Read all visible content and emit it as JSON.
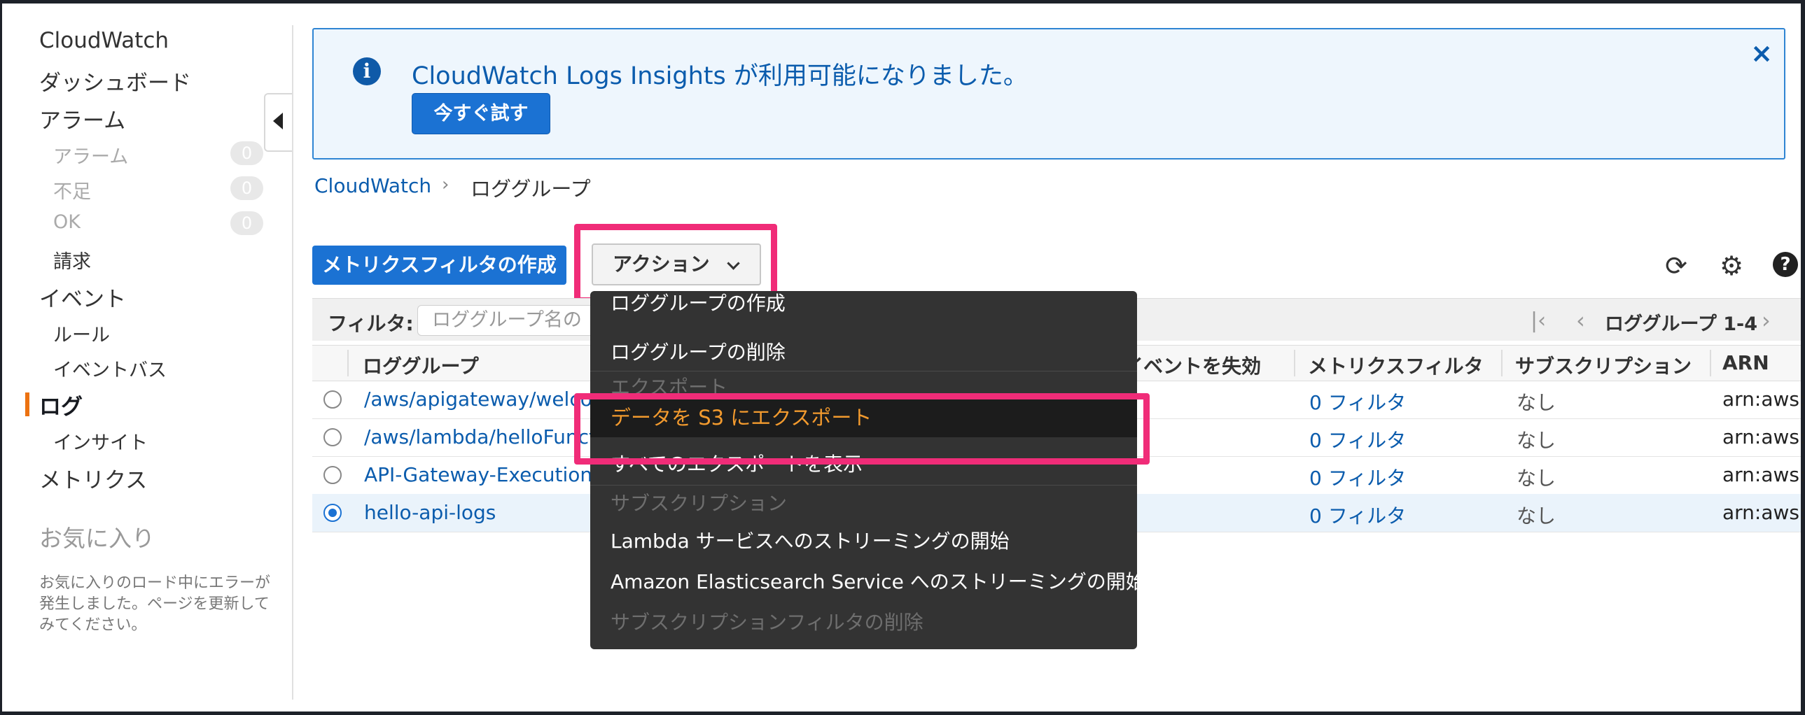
{
  "sidebar": {
    "items": [
      {
        "label": "CloudWatch"
      },
      {
        "label": "ダッシュボード"
      },
      {
        "label": "アラーム"
      },
      {
        "label": "アラーム",
        "count": "0"
      },
      {
        "label": "不足",
        "count": "0"
      },
      {
        "label": "OK",
        "count": "0"
      },
      {
        "label": "請求"
      },
      {
        "label": "イベント"
      },
      {
        "label": "ルール"
      },
      {
        "label": "イベントバス"
      },
      {
        "label": "ログ"
      },
      {
        "label": "インサイト"
      },
      {
        "label": "メトリクス"
      }
    ],
    "favorites_title": "お気に入り",
    "favorites_error": "お気に入りのロード中にエラーが発生しました。ページを更新してみてください。"
  },
  "banner": {
    "message": "CloudWatch Logs Insights が利用可能になりました。",
    "button": "今すぐ試す",
    "close": "×",
    "icon": "info-icon"
  },
  "breadcrumb": {
    "root": "CloudWatch",
    "separator": "›",
    "current": "ロググループ"
  },
  "toolbar": {
    "metric_filter_button": "メトリクスフィルタの作成",
    "actions_button": "アクション",
    "refresh_icon": "⟳",
    "settings_icon": "⚙",
    "help_icon": "?"
  },
  "filter": {
    "label": "フィルタ:",
    "placeholder": "ロググループ名の"
  },
  "pager": {
    "first": "|‹",
    "prev": "‹",
    "text": "ロググループ 1-4",
    "next": "›"
  },
  "table": {
    "columns": [
      "ロググループ",
      "イベントを失効",
      "メトリクスフィルタ",
      "サブスクリプション",
      "ARN"
    ],
    "rows": [
      {
        "name": "/aws/apigateway/welcome",
        "filters": "0 フィルタ",
        "subscription": "なし",
        "arn": "arn:aws:l",
        "selected": false
      },
      {
        "name": "/aws/lambda/helloFunction",
        "filters": "0 フィルタ",
        "subscription": "なし",
        "arn": "arn:aws:l",
        "selected": false
      },
      {
        "name": "API-Gateway-Execution-Logs",
        "filters": "0 フィルタ",
        "subscription": "なし",
        "arn": "arn:aws:l",
        "selected": false
      },
      {
        "name": "hello-api-logs",
        "filters": "0 フィルタ",
        "subscription": "なし",
        "arn": "arn:aws:l",
        "selected": true
      }
    ]
  },
  "actions_menu": {
    "items": [
      {
        "label": "ロググループの作成",
        "state": "partial"
      },
      {
        "label": "ロググループの削除",
        "state": "enabled"
      },
      {
        "label": "エクスポート",
        "state": "header"
      },
      {
        "label": "データを S3 にエクスポート",
        "state": "hover"
      },
      {
        "label": "すべてのエクスポートを表示",
        "state": "enabled"
      },
      {
        "label": "サブスクリプション",
        "state": "header"
      },
      {
        "label": "Lambda サービスへのストリーミングの開始",
        "state": "enabled"
      },
      {
        "label": "Amazon Elasticsearch Service へのストリーミングの開始",
        "state": "enabled"
      },
      {
        "label": "サブスクリプションフィルタの削除",
        "state": "disabled"
      }
    ]
  },
  "colors": {
    "accent": "#1b72d3",
    "link": "#0b5cad",
    "highlight": "#f02c78",
    "active_nav": "#ec7211",
    "menu_hover_text": "#f29a2e"
  }
}
